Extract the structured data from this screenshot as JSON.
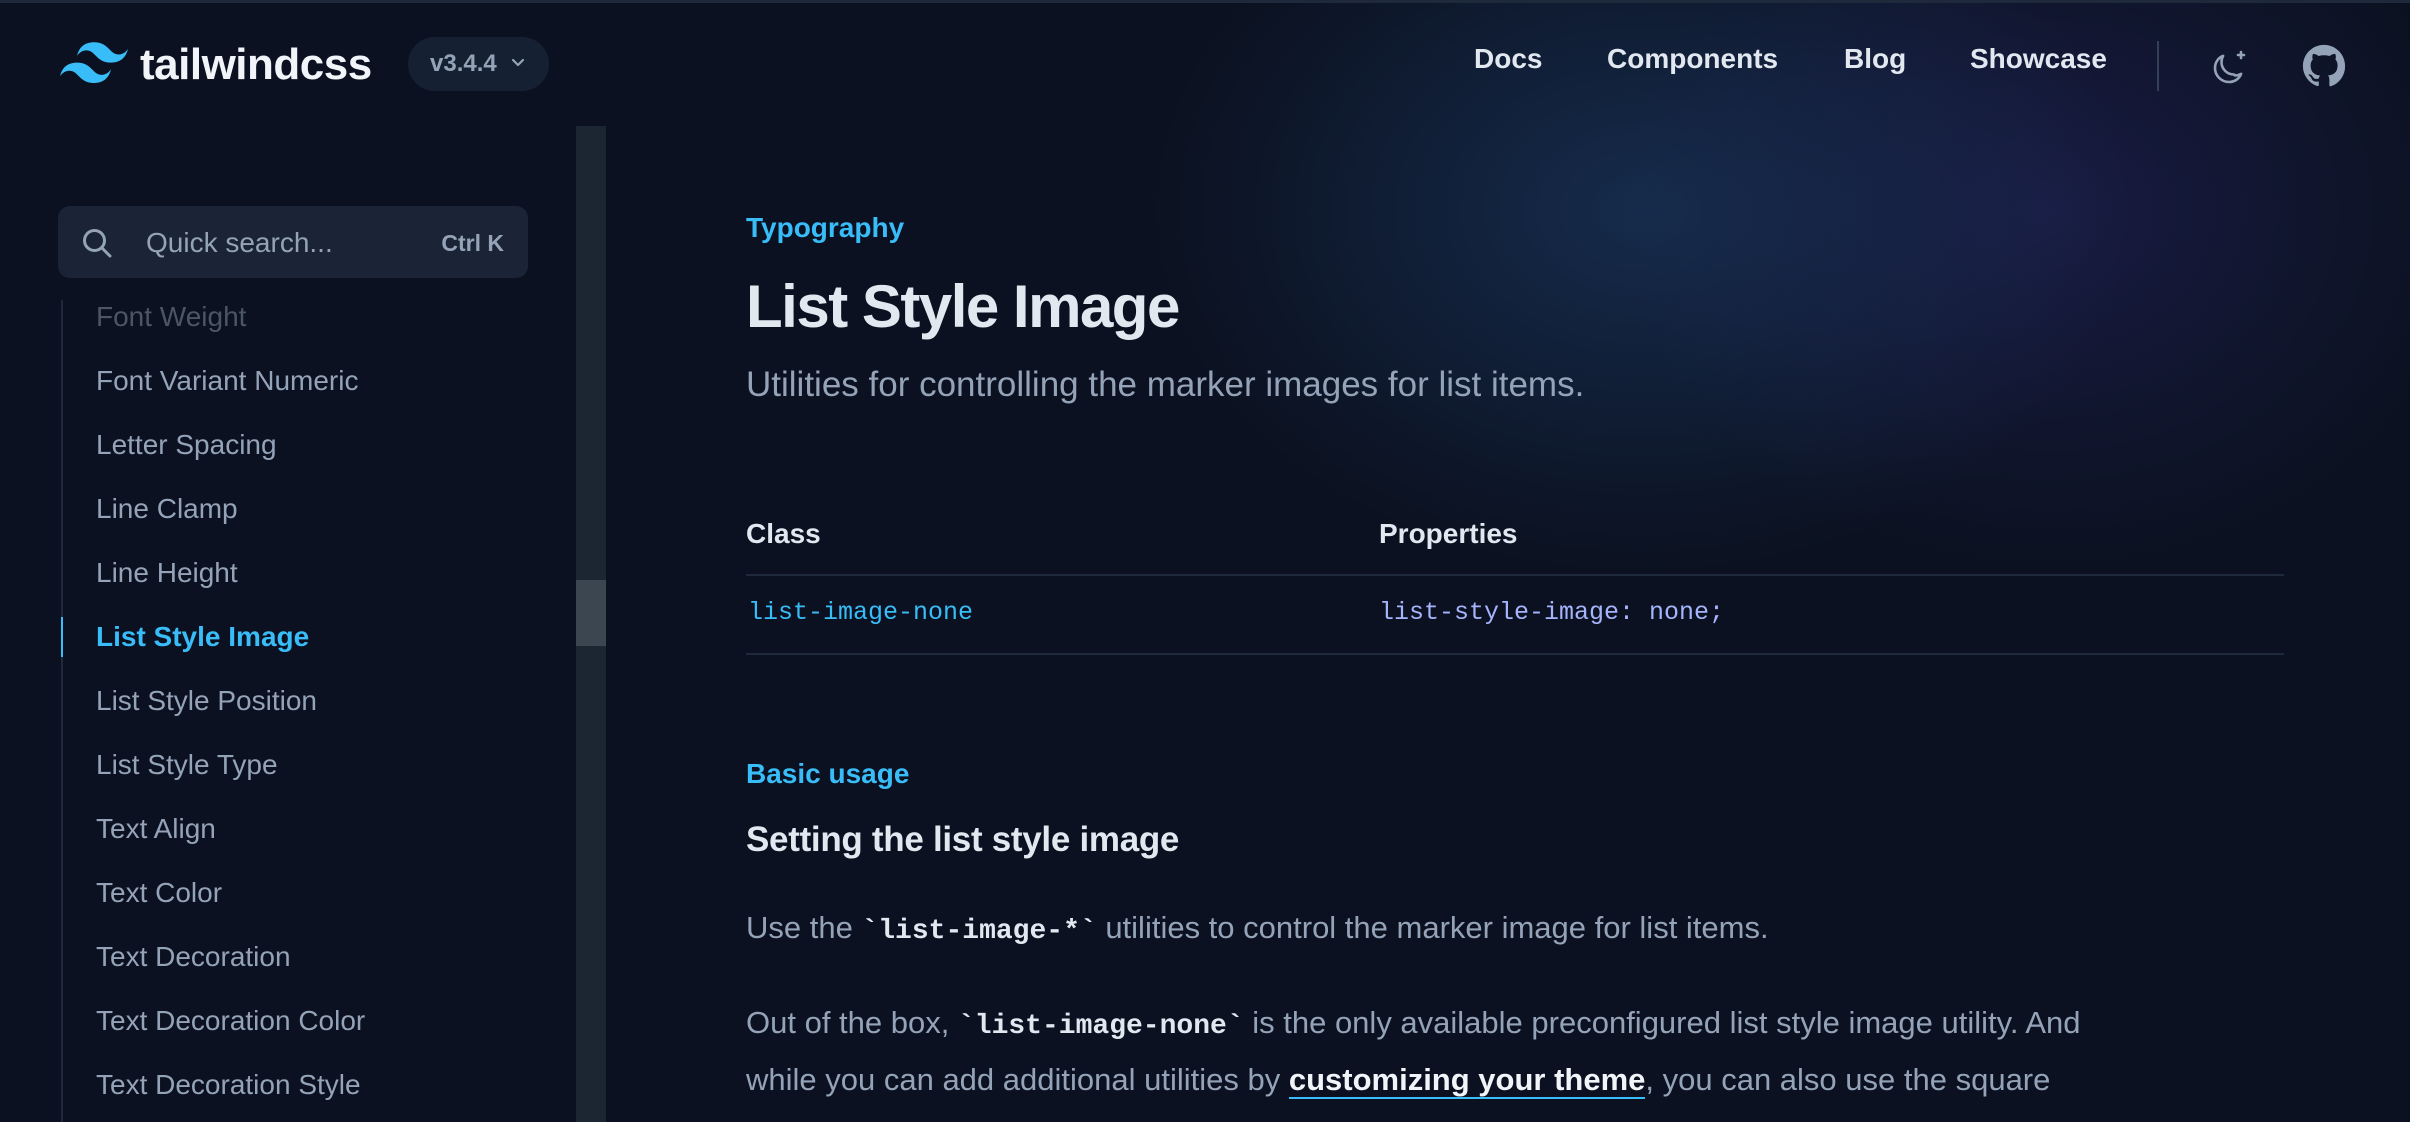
{
  "header": {
    "logo_text": "tailwindcss",
    "version_label": "v3.4.4",
    "nav": {
      "docs": "Docs",
      "components": "Components",
      "blog": "Blog",
      "showcase": "Showcase"
    }
  },
  "sidebar": {
    "search_placeholder": "Quick search...",
    "search_shortcut": "Ctrl K",
    "items": [
      "Font Weight",
      "Font Variant Numeric",
      "Letter Spacing",
      "Line Clamp",
      "Line Height",
      "List Style Image",
      "List Style Position",
      "List Style Type",
      "Text Align",
      "Text Color",
      "Text Decoration",
      "Text Decoration Color",
      "Text Decoration Style"
    ],
    "active_item": "List Style Image"
  },
  "main": {
    "eyebrow": "Typography",
    "title": "List Style Image",
    "subtitle": "Utilities for controlling the marker images for list items.",
    "table": {
      "headers": [
        "Class",
        "Properties"
      ],
      "rows": [
        [
          "list-image-none",
          "list-style-image: none;"
        ]
      ]
    },
    "section_eyebrow": "Basic usage",
    "section_title": "Setting the list style image",
    "para1": {
      "before": "Use the ",
      "code": "`list-image-*`",
      "after": " utilities to control the marker image for list items."
    },
    "para2": {
      "line1_before": "Out of the box, ",
      "line1_code": "`list-image-none`",
      "line1_after": " is the only available preconfigured list style image utility. And",
      "line2_before": "while you can add additional utilities by ",
      "line2_link": "customizing your theme",
      "line2_after": ", you can also use the square"
    }
  },
  "colors": {
    "background": "#0b1120",
    "accent": "#38bdf8",
    "heading": "#e2e8f0",
    "text": "#94a3b8"
  },
  "icons": [
    "tailwind-logo-icon",
    "chevron-down-icon",
    "theme-toggle-icon",
    "github-icon",
    "search-icon"
  ]
}
